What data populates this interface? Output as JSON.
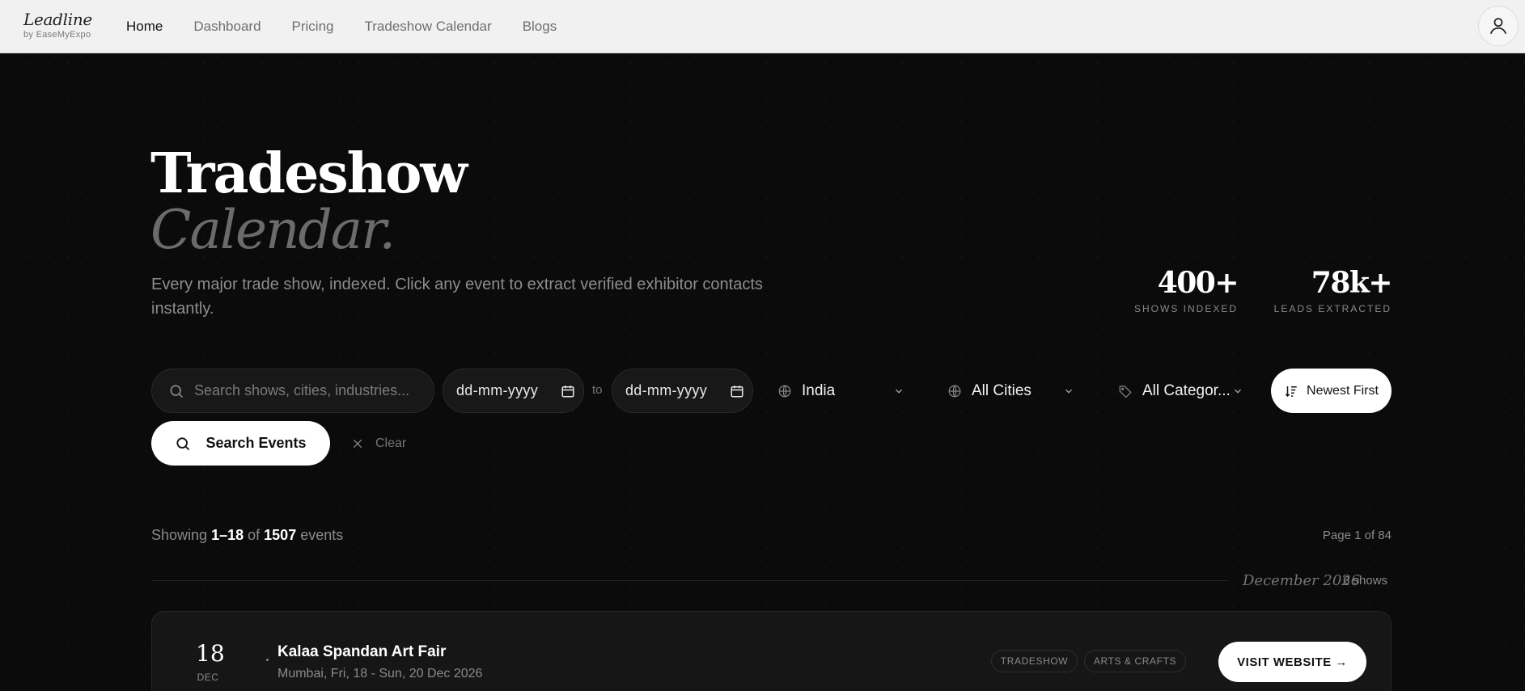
{
  "brand": {
    "name": "Leadline",
    "sub": "by EaseMyExpo"
  },
  "nav": {
    "items": [
      "Home",
      "Dashboard",
      "Pricing",
      "Tradeshow Calendar",
      "Blogs"
    ],
    "active": "Home"
  },
  "hero": {
    "title_line1": "Tradeshow",
    "title_line2": "Calendar.",
    "description": "Every major trade show, indexed. Click any event to extract verified exhibitor contacts instantly."
  },
  "stats": [
    {
      "value": "400+",
      "label": "SHOWS INDEXED"
    },
    {
      "value": "78k+",
      "label": "LEADS EXTRACTED"
    }
  ],
  "filters": {
    "search_placeholder": "Search shows, cities, industries...",
    "date_from": "dd-mm-yyyy",
    "to_label": "to",
    "date_to": "dd-mm-yyyy",
    "country": "India",
    "city": "All Cities",
    "category": "All Categor...",
    "sort": "Newest First",
    "search_button": "Search Events",
    "clear": "Clear"
  },
  "results": {
    "showing_prefix": "Showing",
    "range": "1–18",
    "of": "of",
    "total": "1507",
    "suffix": "events",
    "page_info": "Page 1 of 84"
  },
  "month_group": {
    "month": "December 2026",
    "count": "6 shows"
  },
  "events": [
    {
      "day": "18",
      "month": "DEC",
      "title": "Kalaa Spandan Art Fair",
      "meta": "Mumbai, Fri, 18 - Sun, 20 Dec 2026",
      "tags": [
        "TRADESHOW",
        "ARTS & CRAFTS"
      ],
      "cta": "VISIT WEBSITE →"
    }
  ],
  "colors": {
    "background": "#0b0b0b",
    "nav_bg": "#f1f1f1",
    "accent": "#ffffff",
    "muted": "#8a8a8a"
  },
  "icons": [
    "user-icon",
    "search-icon",
    "calendar-icon",
    "globe-icon",
    "chevron-down-icon",
    "tag-icon",
    "sort-icon",
    "close-icon"
  ]
}
